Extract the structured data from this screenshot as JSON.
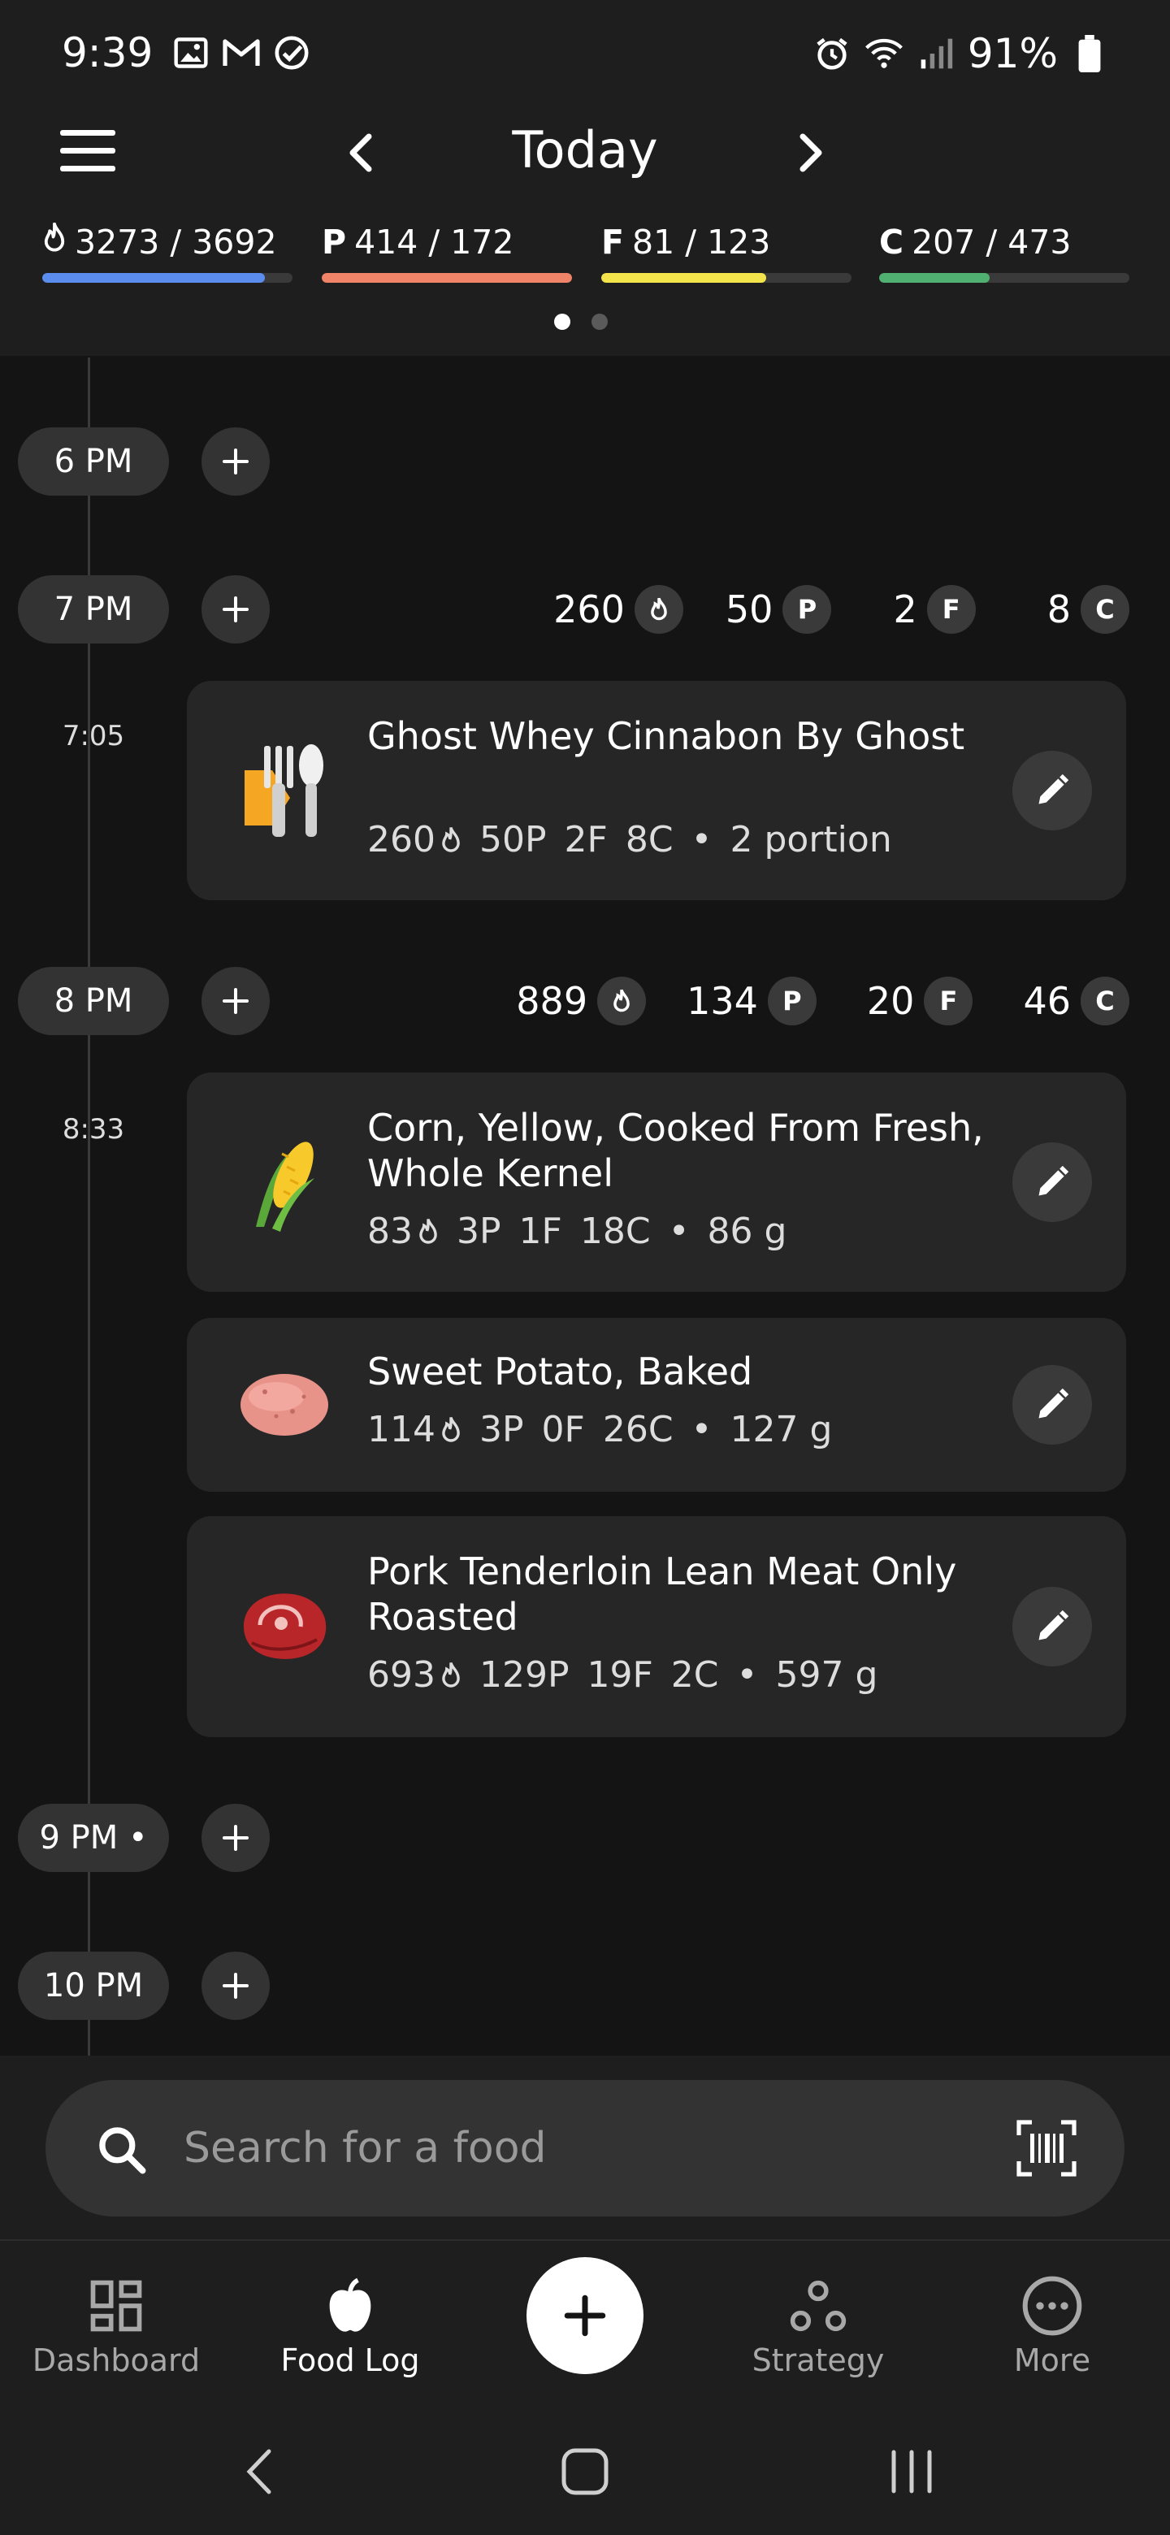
{
  "status_bar": {
    "time": "9:39",
    "battery": "91%"
  },
  "nav": {
    "title": "Today"
  },
  "summary": [
    {
      "letter": "",
      "icon": "flame-icon",
      "value": "3273 / 3692",
      "progress": 0.89,
      "color": "#5b8def"
    },
    {
      "letter": "P",
      "value": "414 / 172",
      "progress": 1.0,
      "color": "#f08468"
    },
    {
      "letter": "F",
      "value": "81 / 123",
      "progress": 0.66,
      "color": "#f4e44c"
    },
    {
      "letter": "C",
      "value": "207 / 473",
      "progress": 0.44,
      "color": "#4fb072"
    }
  ],
  "pages": {
    "count": 2,
    "active": 0
  },
  "hours": [
    {
      "label": "6 PM"
    },
    {
      "label": "7 PM",
      "totals": {
        "cal": "260",
        "p": "50",
        "f": "2",
        "c": "8"
      }
    },
    {
      "label": "8 PM",
      "totals": {
        "cal": "889",
        "p": "134",
        "f": "20",
        "c": "46"
      }
    },
    {
      "label": "9 PM •"
    },
    {
      "label": "10 PM"
    }
  ],
  "badges": {
    "p": "P",
    "f": "F",
    "c": "C"
  },
  "entries": [
    {
      "time": "7:05"
    },
    {
      "time": "8:33"
    }
  ],
  "foods": [
    {
      "name": "Ghost Whey Cinnabon By Ghost",
      "cal": "260",
      "p": "50P",
      "f": "2F",
      "c": "8C",
      "sep": "•",
      "qty": "2 portion",
      "icon": "utensils-icon"
    },
    {
      "name": "Corn, Yellow, Cooked From Fresh, Whole Kernel",
      "cal": "83",
      "p": "3P",
      "f": "1F",
      "c": "18C",
      "sep": "•",
      "qty": "86 g",
      "icon": "corn-icon"
    },
    {
      "name": "Sweet Potato, Baked",
      "cal": "114",
      "p": "3P",
      "f": "0F",
      "c": "26C",
      "sep": "•",
      "qty": "127 g",
      "icon": "potato-icon"
    },
    {
      "name": "Pork Tenderloin Lean Meat Only Roasted",
      "cal": "693",
      "p": "129P",
      "f": "19F",
      "c": "2C",
      "sep": "•",
      "qty": "597 g",
      "icon": "meat-icon"
    }
  ],
  "search": {
    "placeholder": "Search for a food"
  },
  "bottom_nav": [
    {
      "label": "Dashboard",
      "icon": "dashboard-icon"
    },
    {
      "label": "Food Log",
      "icon": "apple-icon",
      "active": true
    },
    {
      "label": "Strategy",
      "icon": "strategy-icon"
    },
    {
      "label": "More",
      "icon": "more-icon"
    }
  ]
}
